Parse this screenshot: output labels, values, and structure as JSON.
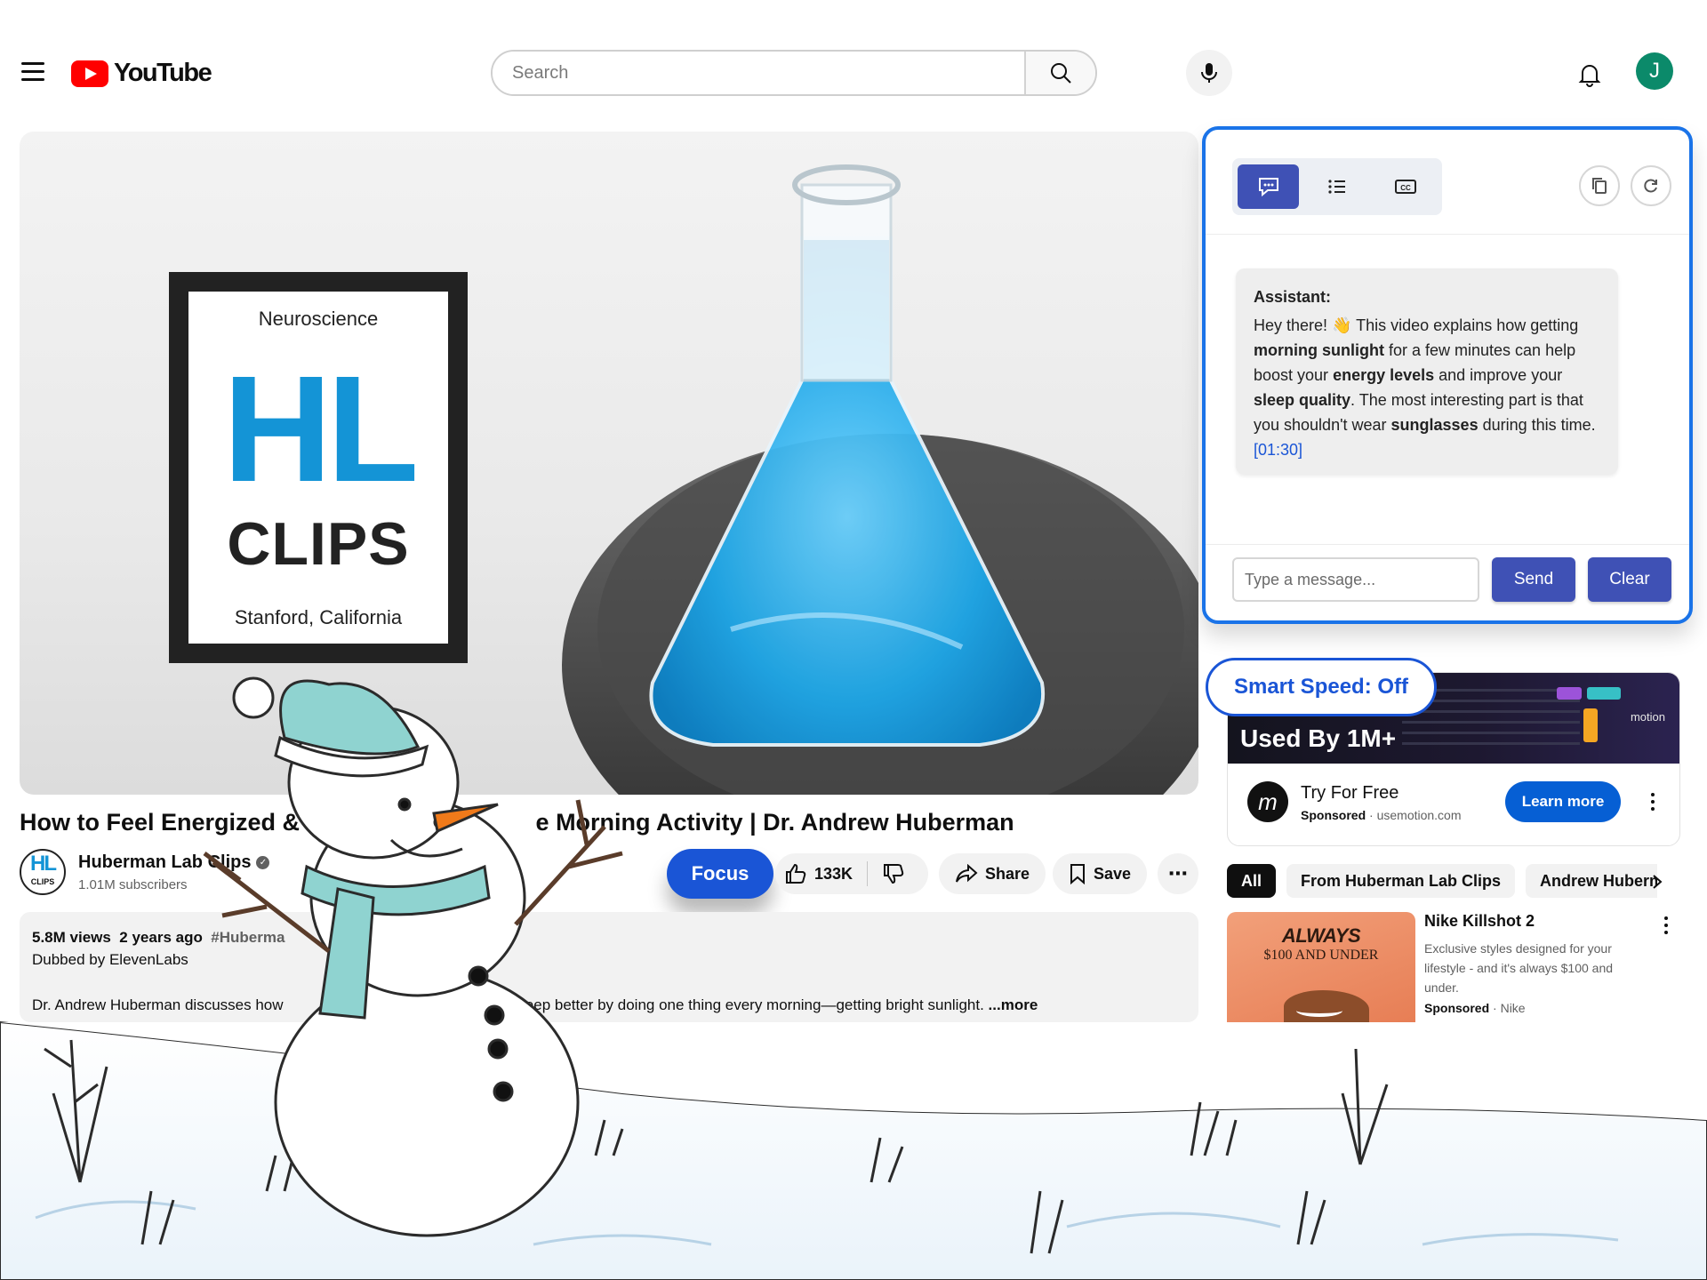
{
  "header": {
    "logo_text": "YouTube",
    "search_placeholder": "Search",
    "avatar_initial": "J"
  },
  "player": {
    "card_top": "Neuroscience",
    "card_letters": "HL",
    "card_clips": "CLIPS",
    "card_bottom": "Stanford, California"
  },
  "video": {
    "title": "How to Feel Energized & S",
    "title_rest": "e Morning Activity | Dr. Andrew Huberman",
    "channel_name": "Huberman Lab Clips",
    "subscribers": "1.01M subscribers",
    "focus_label": "Focus",
    "like_count": "133K",
    "share_label": "Share",
    "save_label": "Save",
    "views": "5.8M views",
    "age": "2 years ago",
    "hashtag": "#Huberma",
    "dubbed": "Dubbed by ElevenLabs",
    "desc_start": "Dr. Andrew Huberman discusses how",
    "desc_end": "sleep better by doing one thing every morning—getting bright sunlight.",
    "more_label": "...more"
  },
  "assistant": {
    "speaker": "Assistant:",
    "msg_1": "Hey there! 👋 This video explains how getting ",
    "bold_1": "morning sunlight",
    "msg_2": " for a few minutes can help boost your ",
    "bold_2": "energy levels",
    "msg_3": " and improve your ",
    "bold_3": "sleep quality",
    "msg_4": ". The most interesting part is that you shouldn't wear ",
    "bold_4": "sunglasses",
    "msg_5": " during this time. ",
    "timestamp": "[01:30]",
    "input_placeholder": "Type a message...",
    "send_label": "Send",
    "clear_label": "Clear"
  },
  "smart_speed": "Smart Speed: Off",
  "ad": {
    "banner_text": "Used By 1M+",
    "banner_brand": "motion",
    "title": "Try For Free",
    "sponsored": "Sponsored",
    "domain": "usemotion.com",
    "cta": "Learn more"
  },
  "chips": [
    "All",
    "From Huberman Lab Clips",
    "Andrew Huberman"
  ],
  "nike": {
    "thumb_line1": "ALWAYS",
    "thumb_line2": "$100 AND UNDER",
    "title": "Nike Killshot 2",
    "desc": "Exclusive styles designed for your lifestyle - and it's always $100 and under.",
    "sponsored": "Sponsored",
    "advertiser": "Nike"
  },
  "colors": {
    "youtube_red": "#ff0000",
    "assistant_border": "#1a73e8",
    "assistant_button": "#3f51b5",
    "focus_button": "#1a55d6",
    "learn_more": "#065fd4",
    "flask_liquid": "#1ea7e8"
  }
}
